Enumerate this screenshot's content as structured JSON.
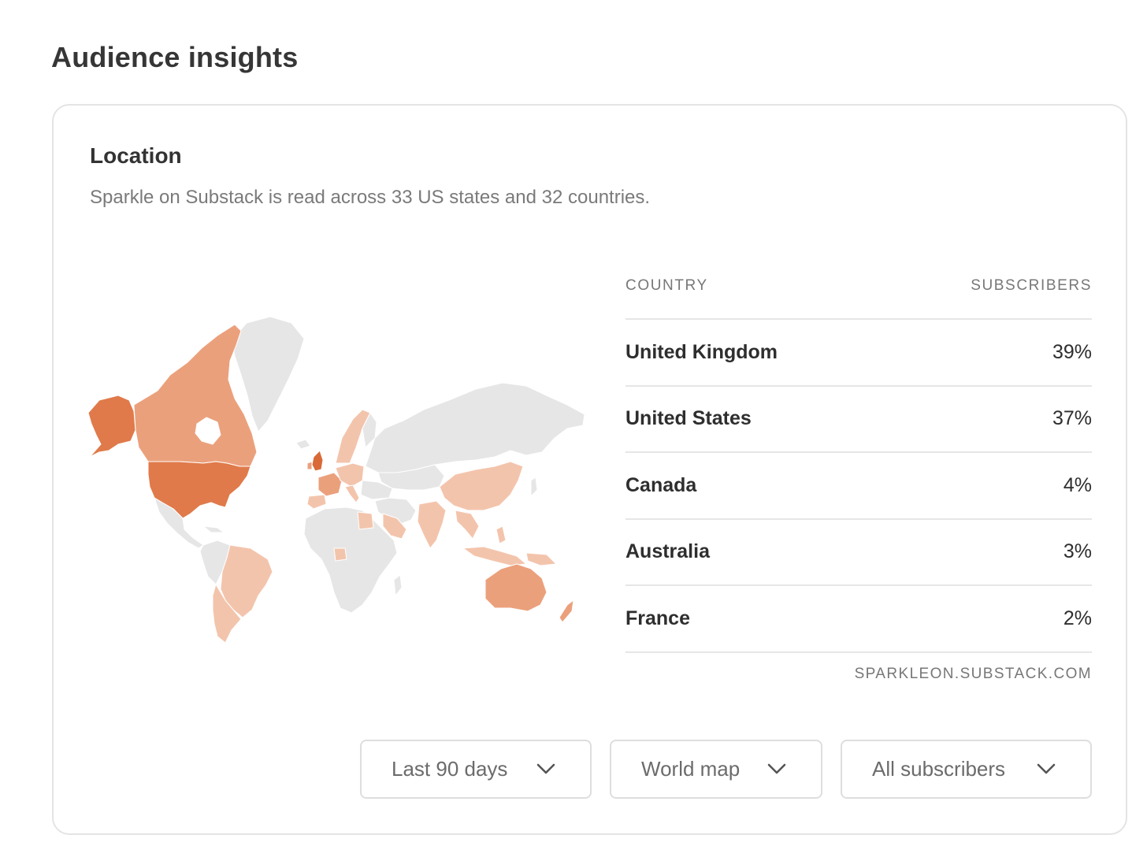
{
  "page": {
    "title": "Audience insights"
  },
  "location": {
    "title": "Location",
    "subtitle": "Sparkle on Substack is read across 33 US states and 32 countries."
  },
  "table": {
    "headers": {
      "country": "COUNTRY",
      "subscribers": "SUBSCRIBERS"
    },
    "rows": [
      {
        "country": "United Kingdom",
        "value": "39%"
      },
      {
        "country": "United States",
        "value": "37%"
      },
      {
        "country": "Canada",
        "value": "4%"
      },
      {
        "country": "Australia",
        "value": "3%"
      },
      {
        "country": "France",
        "value": "2%"
      }
    ],
    "source": "SPARKLEON.SUBSTACK.COM"
  },
  "filters": {
    "range": "Last 90 days",
    "view": "World map",
    "audience": "All subscribers"
  },
  "colors": {
    "land": "#e6e6e6",
    "scale_strong": "#e07a4a",
    "scale_medium": "#eba07c",
    "scale_light": "#f3c4ac"
  },
  "icons": {
    "dropdown": "chevron-down-icon"
  }
}
